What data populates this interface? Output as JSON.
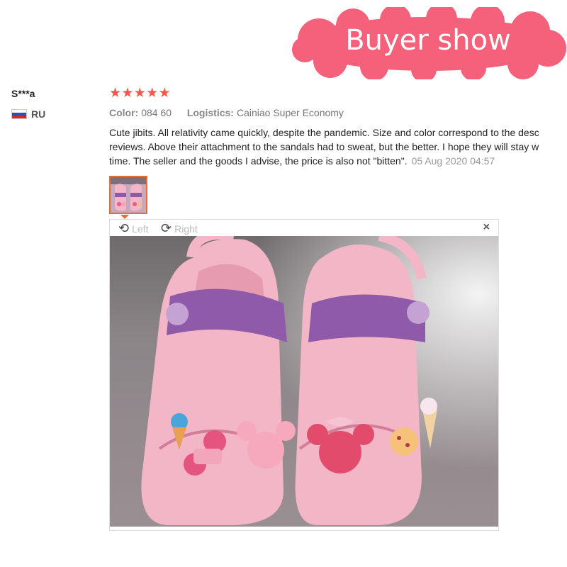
{
  "banner": {
    "text": "Buyer show",
    "color": "#f5607a"
  },
  "user": {
    "name": "S***a",
    "country": "RU"
  },
  "review": {
    "rating": 5,
    "stars": [
      "★",
      "★",
      "★",
      "★",
      "★"
    ],
    "color_label": "Color:",
    "color_value": "084 60",
    "logistics_label": "Logistics:",
    "logistics_value": "Cainiao Super Economy",
    "text_line1": "Cute jibits. All relativity came quickly, despite the pandemic. Size and color correspond to the desc",
    "text_line2": "reviews. Above their attachment to the sandals had to sweat, but the better. I hope they will stay w",
    "text_line3": "time. The seller and the goods I advise, the price is also not \"bitten\".",
    "date": "05 Aug 2020 04:57"
  },
  "viewer": {
    "rotate_left_label": "Left",
    "rotate_right_label": "Right",
    "close_label": "×"
  },
  "colors": {
    "star": "#f05a4a",
    "accent": "#e0703a"
  }
}
